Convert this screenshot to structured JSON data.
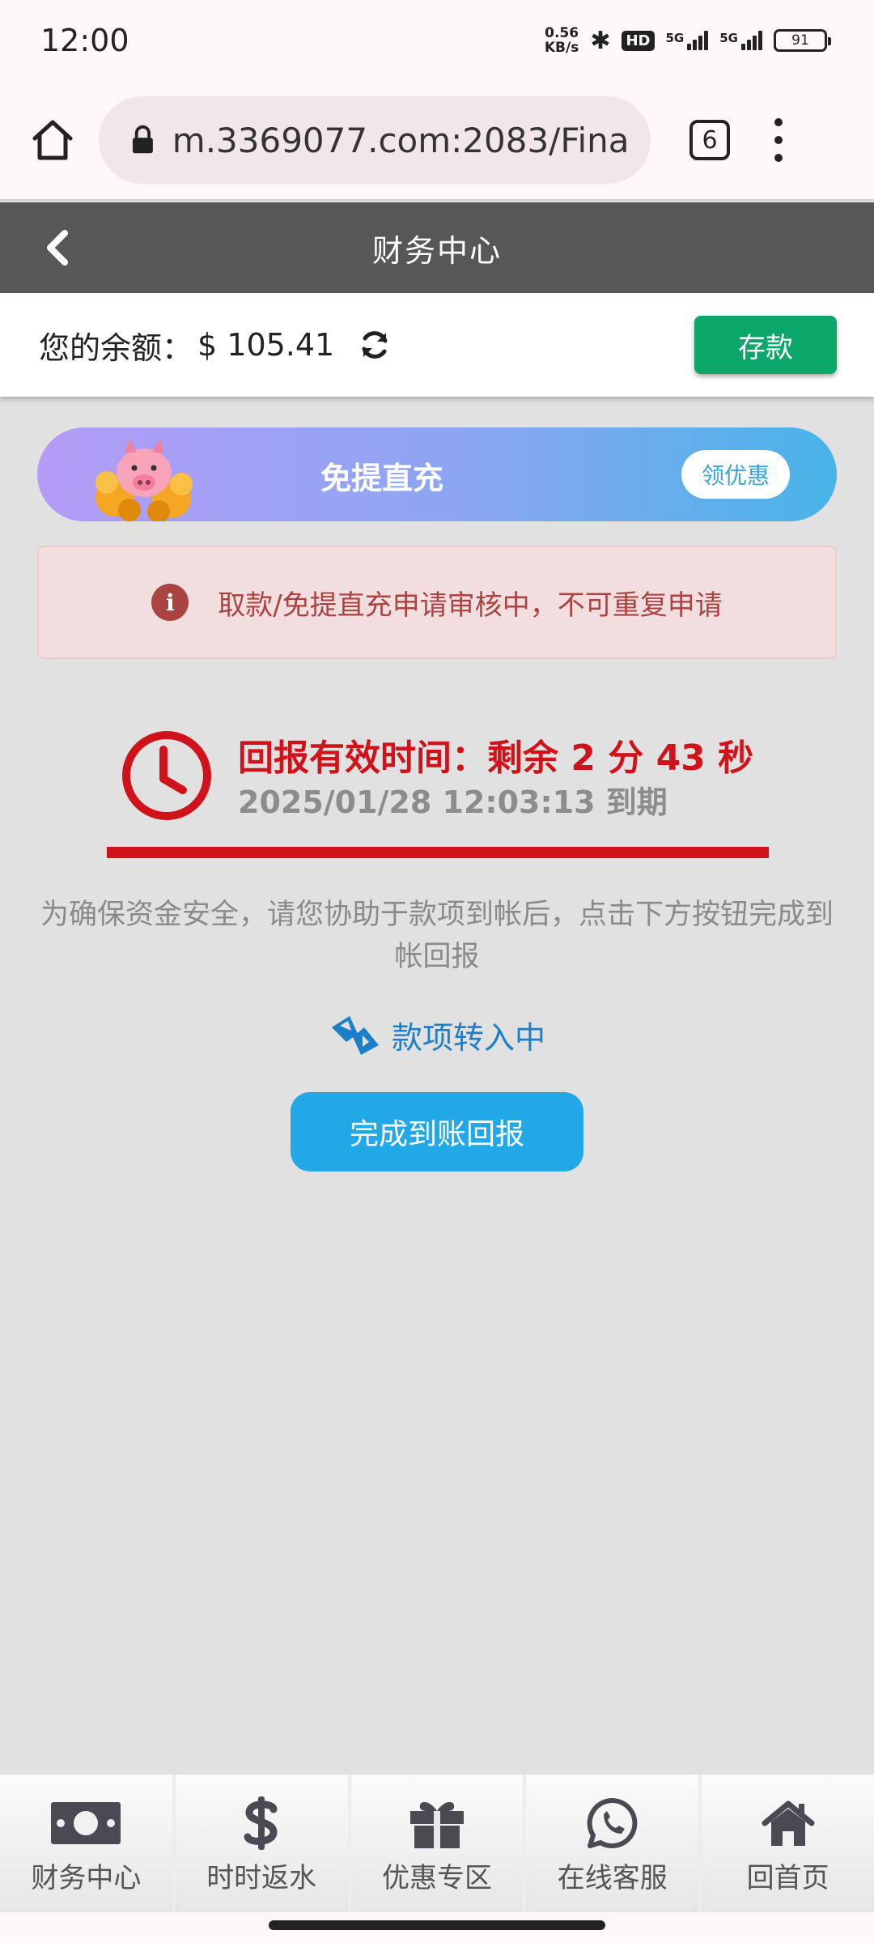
{
  "status_bar": {
    "time": "12:00",
    "net_speed_value": "0.56",
    "net_speed_unit": "KB/s",
    "hd_label": "HD",
    "signal1_label": "5G",
    "signal2_label": "5G",
    "battery": "91"
  },
  "browser": {
    "url": "m.3369077.com:2083/Finan",
    "tab_count": "6"
  },
  "header": {
    "title": "财务中心"
  },
  "balance": {
    "label": "您的余额：",
    "value": "$ 105.41",
    "deposit_label": "存款"
  },
  "promo": {
    "title": "免提直充",
    "button_label": "领优惠"
  },
  "alert": {
    "icon": "i",
    "text": "取款/免提直充申请审核中，不可重复申请"
  },
  "countdown": {
    "headline": "回报有效时间：剩余 2 分 43 秒",
    "expiry": "2025/01/28 12:03:13 到期"
  },
  "instruction": "为确保资金安全，请您协助于款项到帐后，点击下方按钮完成到帐回报",
  "transfer": {
    "status_text": "款项转入中"
  },
  "confirm_button": "完成到账回报",
  "bottom_nav": {
    "items": [
      {
        "label": "财务中心",
        "icon": "money-icon"
      },
      {
        "label": "时时返水",
        "icon": "dollar-icon"
      },
      {
        "label": "优惠专区",
        "icon": "gift-icon"
      },
      {
        "label": "在线客服",
        "icon": "whatsapp-icon"
      },
      {
        "label": "回首页",
        "icon": "home-icon"
      }
    ]
  },
  "colors": {
    "header_bg": "#575757",
    "deposit_green": "#0aa66a",
    "countdown_red": "#d0131b",
    "confirm_blue": "#22a8e6",
    "alert_text": "#a94442",
    "transfer_blue": "#1b7fc9"
  }
}
